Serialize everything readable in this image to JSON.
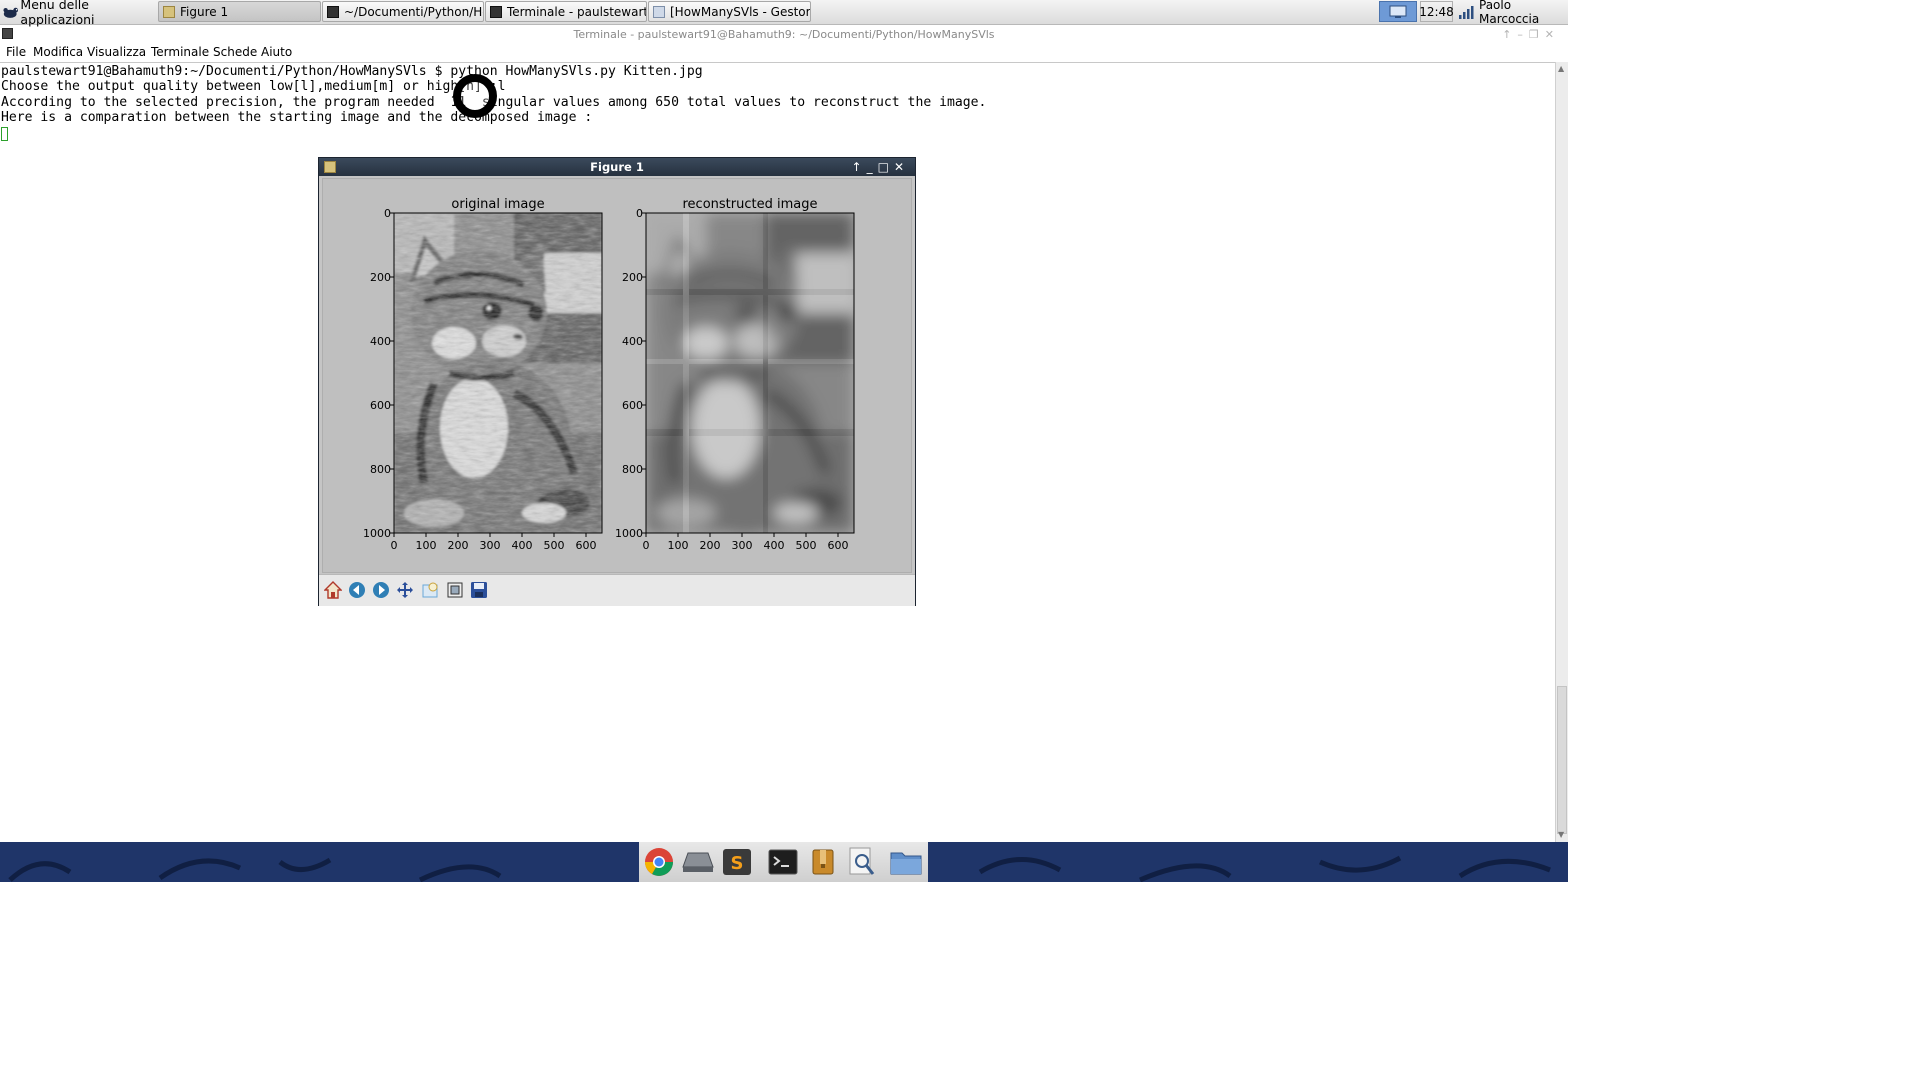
{
  "top_panel": {
    "app_menu_label": "Menu delle applicazioni",
    "tasks": [
      {
        "label": "Figure 1",
        "icon": "matplotlib-icon",
        "active": true
      },
      {
        "label": "~/Documenti/Python/Ho...",
        "icon": "terminal-icon",
        "active": false
      },
      {
        "label": "Terminale - paulstewart...",
        "icon": "terminal-icon",
        "active": false
      },
      {
        "label": "[HowManySVls - Gestor...",
        "icon": "folder-icon",
        "active": false
      }
    ],
    "workspace_icon": "workspace-switcher-icon",
    "clock": "12:48",
    "network_icon": "signal-strength-icon",
    "user": "Paolo Marcoccia"
  },
  "terminal": {
    "window_title": "Terminale - paulstewart91@Bahamuth9: ~/Documenti/Python/HowManySVls",
    "menu": [
      "File",
      "Modifica",
      "Visualizza",
      "Terminale",
      "Schede",
      "Aiuto"
    ],
    "lines": [
      "paulstewart91@Bahamuth9:~/Documenti/Python/HowManySVls $ python HowManySVls.py Kitten.jpg",
      "Choose the output quality between low[l],medium[m] or high[h] :l",
      "According to the selected precision, the program needed  11  singular values among 650 total values to reconstruct the image.",
      "Here is a comparation between the starting image and the decomposed image :"
    ]
  },
  "figure": {
    "window_title": "Figure 1",
    "toolbar": [
      {
        "name": "home-icon",
        "color": "#c0392b"
      },
      {
        "name": "back-arrow-icon",
        "color": "#2f7fb5"
      },
      {
        "name": "forward-arrow-icon",
        "color": "#2f7fb5"
      },
      {
        "name": "pan-move-icon",
        "color": "#2b4f9a"
      },
      {
        "name": "zoom-rect-icon",
        "color": "#6aa8d8"
      },
      {
        "name": "configure-subplots-icon",
        "color": "#333333"
      },
      {
        "name": "save-icon",
        "color": "#2b4f9a"
      }
    ]
  },
  "chart_data": [
    {
      "type": "heatmap",
      "title": "original image",
      "xlabel": "",
      "ylabel": "",
      "xlim": [
        0,
        650
      ],
      "ylim": [
        1000,
        0
      ],
      "xticks": [
        0,
        100,
        200,
        300,
        400,
        500,
        600
      ],
      "yticks": [
        0,
        200,
        400,
        600,
        800,
        1000
      ],
      "colormap": "gray",
      "grid": false
    },
    {
      "type": "heatmap",
      "title": "reconstructed image",
      "xlabel": "",
      "ylabel": "",
      "xlim": [
        0,
        650
      ],
      "ylim": [
        1000,
        0
      ],
      "xticks": [
        0,
        100,
        200,
        300,
        400,
        500,
        600
      ],
      "yticks": [
        0,
        200,
        400,
        600,
        800,
        1000
      ],
      "colormap": "gray",
      "grid": false
    }
  ],
  "dock": [
    {
      "name": "chrome-icon"
    },
    {
      "name": "drive-icon"
    },
    {
      "name": "sublime-text-icon"
    },
    {
      "name": "terminal-icon"
    },
    {
      "name": "archive-manager-icon"
    },
    {
      "name": "image-viewer-icon"
    },
    {
      "name": "file-manager-icon"
    }
  ]
}
